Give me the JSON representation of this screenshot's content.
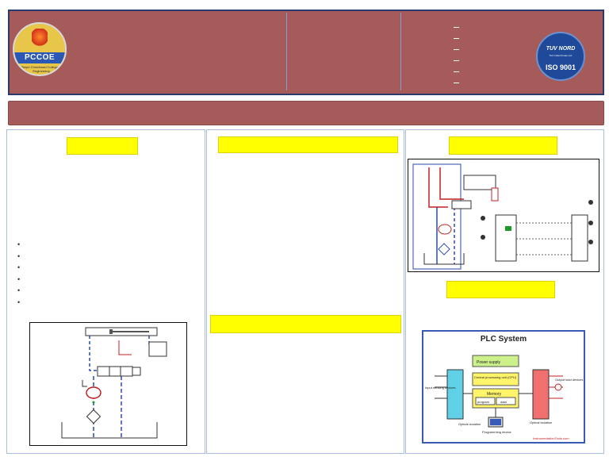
{
  "header": {
    "logo_left": {
      "name": "PCCOE",
      "tagline": "Knowledge Brings Freedom",
      "sub_text": "Pimpri Chinchwad College of Engineering",
      "since": "Since 1999"
    },
    "logo_right": {
      "brand": "TUV NORD",
      "sub_text": "TUV India Private Ltd.",
      "cert": "ISO 9001"
    },
    "dash_items": [
      "",
      "",
      "",
      "",
      "",
      ""
    ]
  },
  "left_column": {
    "bullets": [
      "•",
      "•",
      "•",
      "•",
      "•",
      "•"
    ]
  },
  "figures": {
    "plc_system": {
      "title": "PLC System",
      "power_supply": "Power supply",
      "cpu": "Central processing unit (CPU)",
      "memory": "Memory",
      "program": "program",
      "data": "data",
      "input_devices": "Input sensing devices",
      "output_devices": "Output load devices",
      "optical_left": "Optical isolation",
      "optical_right": "Optical isolation",
      "programming_device": "Programming device",
      "source": "InstrumentationTools.com",
      "inputs_word": "Inputs",
      "outputs_word": "Outputs"
    }
  },
  "colors": {
    "header_bg": "#a65b5b",
    "border": "#2a3a6a",
    "highlight": "#ffff00",
    "panel_border": "#a6bde0"
  }
}
